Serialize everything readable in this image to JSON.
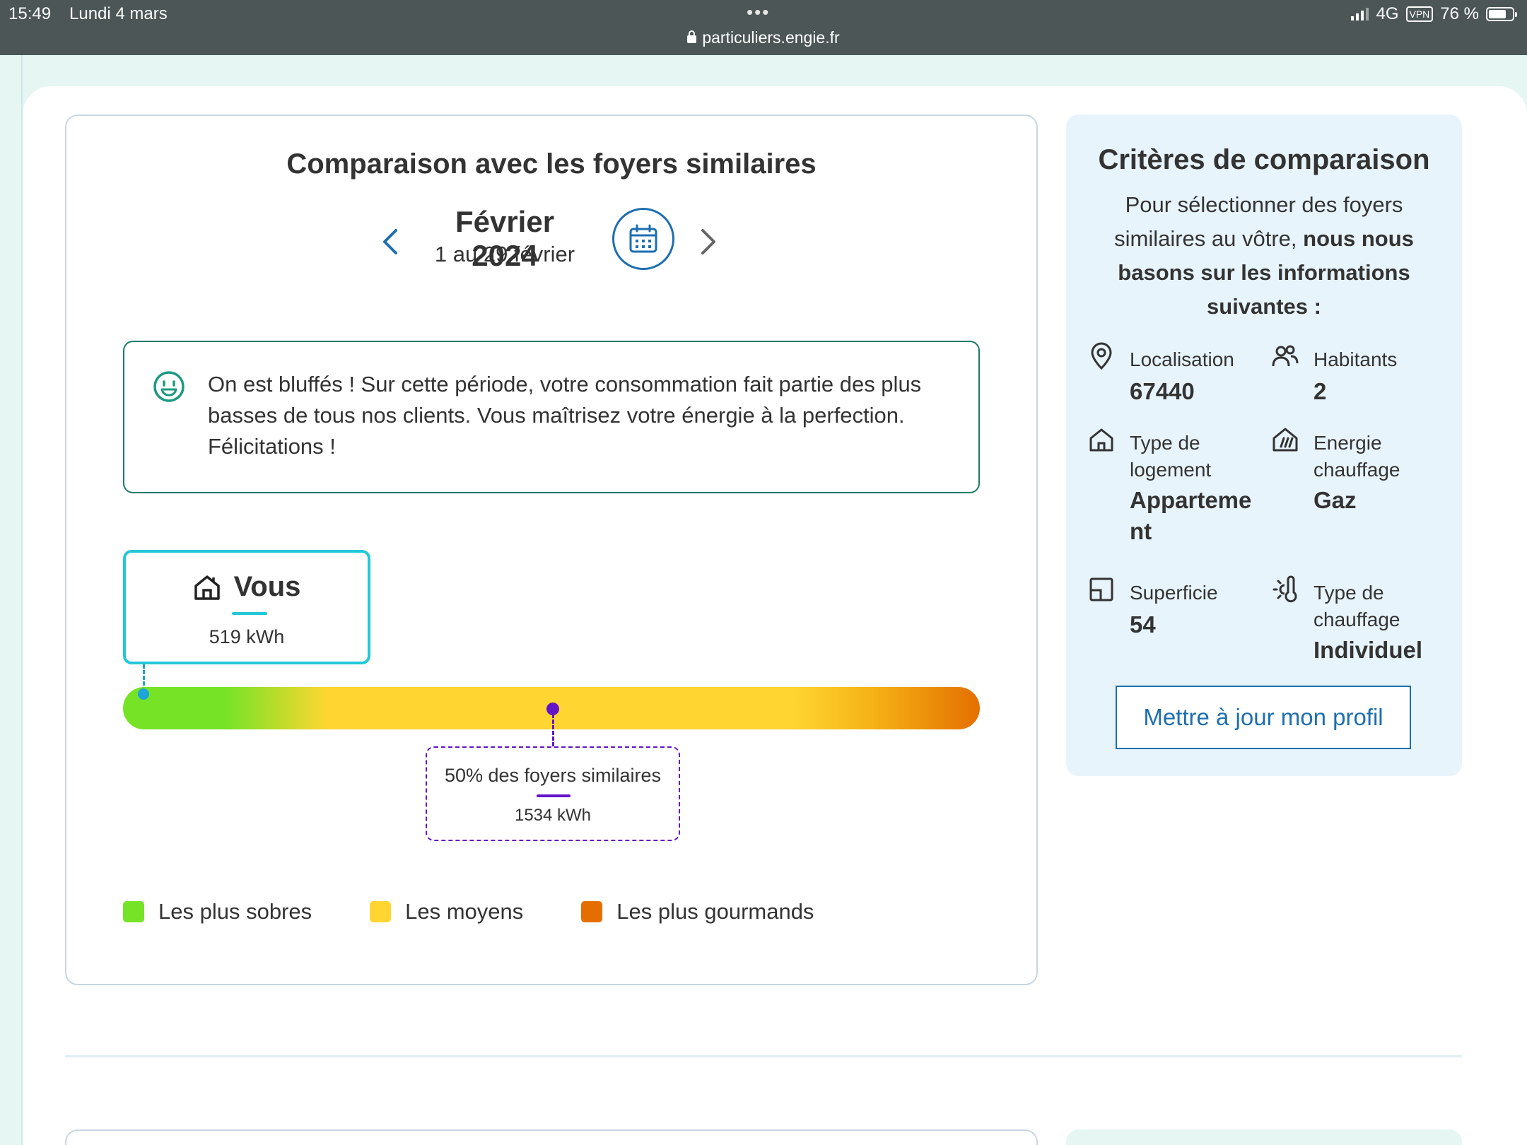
{
  "status_bar": {
    "time": "15:49",
    "date": "Lundi 4 mars",
    "dots": "•••",
    "url": "particuliers.engie.fr",
    "network": "4G",
    "vpn": "VPN",
    "battery": "76 %"
  },
  "comparison": {
    "title": "Comparaison avec les foyers similaires",
    "period_month": "Février 2024",
    "period_range": "1 au 29 février",
    "message": "On est bluffés ! Sur cette période, votre consommation fait partie des plus basses de tous nos clients. Vous maîtrisez votre énergie à la perfection. Félicitations !",
    "you": {
      "label": "Vous",
      "value": "519 kWh"
    },
    "average": {
      "label": "50% des foyers similaires",
      "value": "1534 kWh"
    },
    "legend": [
      {
        "label": "Les plus sobres",
        "color": "#76e327"
      },
      {
        "label": "Les moyens",
        "color": "#ffd631"
      },
      {
        "label": "Les plus gourmands",
        "color": "#e46f00"
      }
    ]
  },
  "criteria": {
    "title": "Critères de comparaison",
    "intro_regular": "Pour sélectionner des foyers similaires au vôtre, ",
    "intro_bold": "nous nous basons sur les informations suivantes :",
    "items": [
      {
        "icon": "location-pin-icon",
        "label": "Localisation",
        "value": "67440"
      },
      {
        "icon": "people-icon",
        "label": "Habitants",
        "value": "2"
      },
      {
        "icon": "house-icon",
        "label": "Type de logement",
        "value": "Appartement"
      },
      {
        "icon": "heating-energy-icon",
        "label": "Energie chauffage",
        "value": "Gaz"
      },
      {
        "icon": "surface-icon",
        "label": "Superficie",
        "value": "54"
      },
      {
        "icon": "thermometer-icon",
        "label": "Type de chauffage",
        "value": "Individuel"
      }
    ],
    "update_button": "Mettre à jour mon profil"
  },
  "colors": {
    "accent_blue": "#1d6fb0",
    "you_cyan": "#23c8d8",
    "average_purple": "#6314c9",
    "message_border": "#1c7a6b"
  }
}
